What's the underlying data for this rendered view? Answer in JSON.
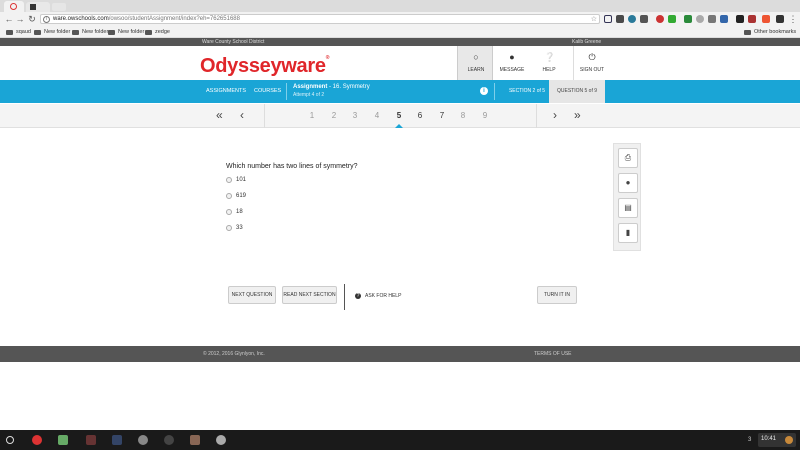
{
  "browser": {
    "url_host": "ware.owschools.com",
    "url_path": "/owsoo/studentAssignment/index?eh=762651688",
    "bookmarks": [
      "sqaud",
      "New folder",
      "New folder",
      "New folder",
      "zedge"
    ],
    "other_bookmarks": "Other bookmarks"
  },
  "district_bar": {
    "district": "Ware County School District",
    "user": "Kalib Greene"
  },
  "header": {
    "logo": "Odysseyware",
    "logo_mark": "®",
    "buttons": [
      {
        "label": "LEARN",
        "icon": "lightbulb-icon"
      },
      {
        "label": "MESSAGE",
        "icon": "chat-bubble-icon"
      },
      {
        "label": "HELP",
        "icon": "question-circle-icon"
      },
      {
        "label": "SIGN OUT",
        "icon": "power-icon"
      }
    ]
  },
  "nav": {
    "assignments": "ASSIGNMENTS",
    "courses": "COURSES",
    "assignment_label": "Assignment",
    "assignment_name": "- 16. Symmetry",
    "attempt": "Attempt 4 of 2",
    "section": "SECTION 2 of 5",
    "question": "QUESTION 5 of 9"
  },
  "pager": {
    "pages": [
      "1",
      "2",
      "3",
      "4",
      "5",
      "6",
      "7",
      "8",
      "9"
    ],
    "current": "5"
  },
  "question": {
    "text": "Which number has two lines of symmetry?",
    "options": [
      "101",
      "619",
      "18",
      "33"
    ]
  },
  "tools": [
    "printer-icon",
    "globe-icon",
    "translate-icon",
    "microphone-icon"
  ],
  "actions": {
    "next_question": "NEXT QUESTION",
    "read_next_section": "READ NEXT SECTION",
    "ask_for_help": "ASK FOR HELP",
    "turn_it_in": "TURN IT IN"
  },
  "footer": {
    "copyright": "© 2012, 2016 Glynlyon, Inc.",
    "terms": "TERMS OF USE"
  },
  "taskbar": {
    "notifications": "3",
    "clock": "10:41"
  },
  "colors": {
    "brand_red": "#e0262a",
    "nav_blue": "#1aa5d6",
    "dark_bar": "#555555"
  }
}
